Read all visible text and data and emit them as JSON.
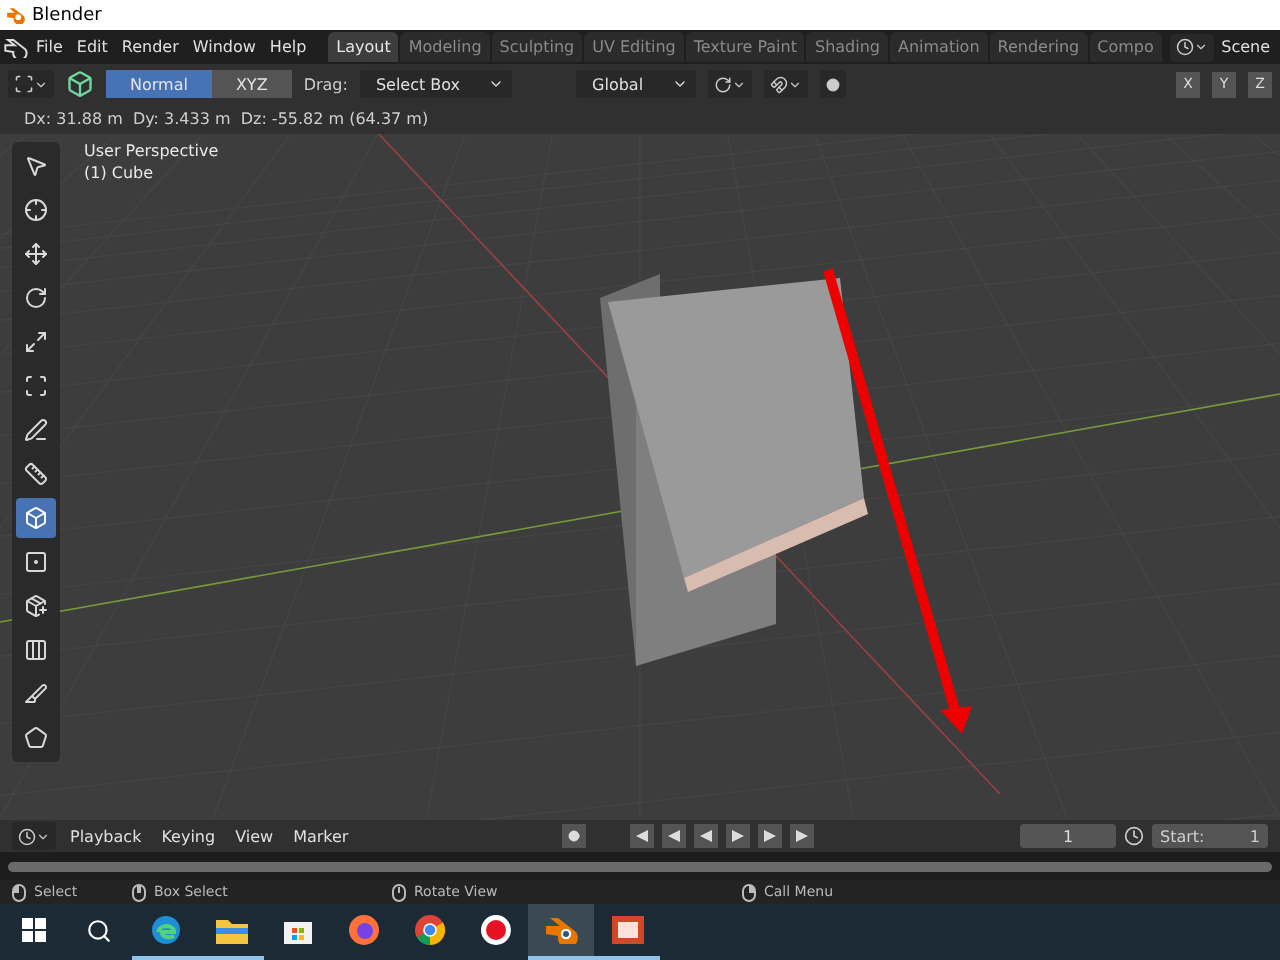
{
  "window": {
    "title": "Blender"
  },
  "menu": [
    "File",
    "Edit",
    "Render",
    "Window",
    "Help"
  ],
  "workspaces": [
    {
      "label": "Layout",
      "selected": true
    },
    {
      "label": "Modeling",
      "selected": false
    },
    {
      "label": "Sculpting",
      "selected": false
    },
    {
      "label": "UV Editing",
      "selected": false
    },
    {
      "label": "Texture Paint",
      "selected": false
    },
    {
      "label": "Shading",
      "selected": false
    },
    {
      "label": "Animation",
      "selected": false
    },
    {
      "label": "Rendering",
      "selected": false
    },
    {
      "label": "Compo",
      "selected": false
    }
  ],
  "scene": "Scene",
  "header": {
    "modes": [
      {
        "label": "Normal",
        "selected": true
      },
      {
        "label": "XYZ",
        "selected": false
      }
    ],
    "drag_label": "Drag:",
    "drag_value": "Select Box",
    "orientation": "Global",
    "axes": [
      "X",
      "Y",
      "Z"
    ]
  },
  "transform_readout": "Dx: 31.88 m  Dy: 3.433 m  Dz: -55.82 m (64.37 m)",
  "viewport": {
    "view_name": "User Perspective",
    "object_name": "(1) Cube"
  },
  "tools": [
    {
      "kind": "select",
      "selected": false
    },
    {
      "kind": "cursor",
      "selected": false
    },
    {
      "kind": "move",
      "selected": false
    },
    {
      "kind": "rotate",
      "selected": false
    },
    {
      "kind": "scale",
      "selected": false
    },
    {
      "kind": "transform",
      "selected": false
    },
    {
      "kind": "annotate",
      "selected": false
    },
    {
      "kind": "measure",
      "selected": false
    },
    {
      "kind": "add-cube",
      "selected": true
    },
    {
      "kind": "inset",
      "selected": false
    },
    {
      "kind": "extrude",
      "selected": false
    },
    {
      "kind": "loop-cut",
      "selected": false
    },
    {
      "kind": "knife",
      "selected": false
    },
    {
      "kind": "poly",
      "selected": false
    }
  ],
  "timeline": {
    "menus": [
      "Playback",
      "Keying",
      "View",
      "Marker"
    ],
    "current_frame": "1",
    "start_label": "Start:",
    "start_value": "1"
  },
  "status_bar": [
    {
      "kind": "left",
      "label": "Select"
    },
    {
      "kind": "middle",
      "label": "Box Select"
    },
    {
      "kind": "wheel",
      "label": "Rotate View"
    },
    {
      "kind": "right",
      "label": "Call Menu"
    }
  ],
  "taskbar": [
    {
      "kind": "start",
      "running": false,
      "selected": false
    },
    {
      "kind": "search",
      "running": false,
      "selected": false
    },
    {
      "kind": "edge",
      "running": true,
      "selected": false
    },
    {
      "kind": "explorer",
      "running": true,
      "selected": false
    },
    {
      "kind": "store",
      "running": false,
      "selected": false
    },
    {
      "kind": "firefox",
      "running": false,
      "selected": false
    },
    {
      "kind": "chrome",
      "running": false,
      "selected": false
    },
    {
      "kind": "recorder",
      "running": false,
      "selected": false
    },
    {
      "kind": "blender",
      "running": true,
      "selected": true
    },
    {
      "kind": "slides",
      "running": true,
      "selected": false
    }
  ]
}
